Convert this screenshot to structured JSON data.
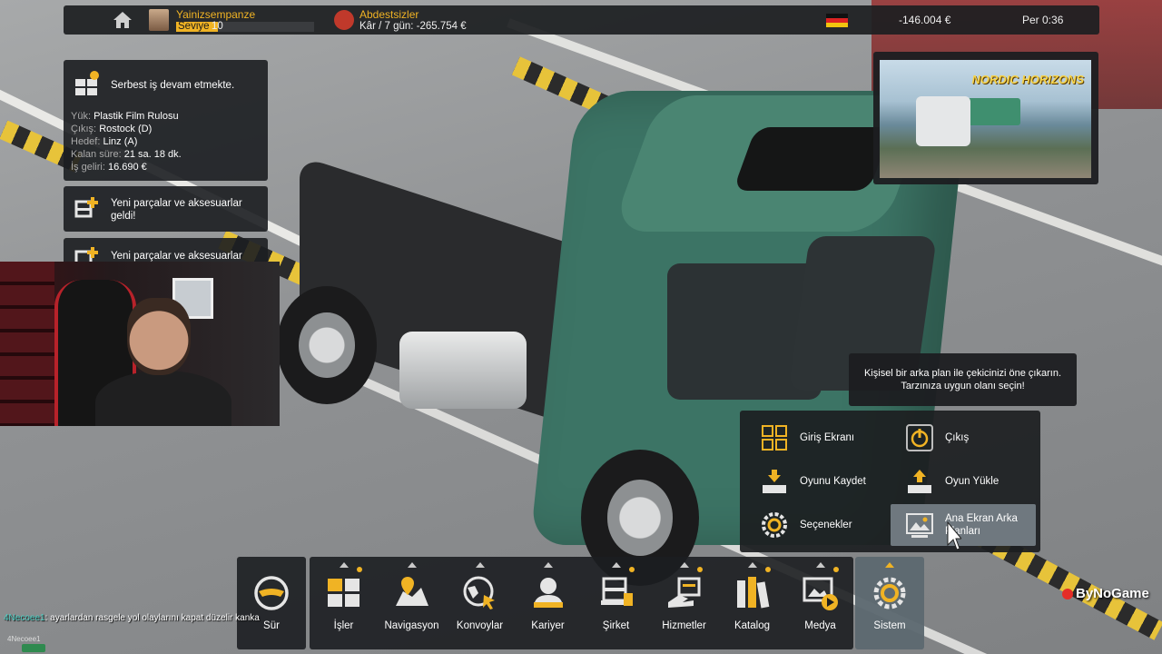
{
  "topbar": {
    "user_name": "Yainizsempanze",
    "level_label": "Seviye",
    "level_value": "10",
    "level_progress": 0.3,
    "company_name": "Abdestsizler",
    "company_stat": "Kâr / 7 gün: -265.754 €",
    "money": "-146.004 €",
    "time": "Per 0:36"
  },
  "notifications": {
    "job": {
      "title": "Serbest iş devam etmekte.",
      "cargo_label": "Yük:",
      "cargo_value": "Plastik Film Rulosu",
      "origin_label": "Çıkış:",
      "origin_value": "Rostock (D)",
      "destination_label": "Hedef:",
      "destination_value": "Linz (A)",
      "remaining_label": "Kalan süre:",
      "remaining_value": "21 sa. 18 dk.",
      "income_label": "İş geliri:",
      "income_value": "16.690 €"
    },
    "parts1": {
      "line1": "Yeni parçalar ve aksesuarlar",
      "line2": "geldi!"
    },
    "parts2": {
      "line1": "Yeni parçalar ve aksesuarlar"
    }
  },
  "promo": {
    "title": "NORDIC HORIZONS"
  },
  "tooltip": {
    "line1": "Kişisel bir arka plan ile çekicinizi öne çıkarın.",
    "line2": "Tarzınıza uygun olanı seçin!"
  },
  "system_menu": {
    "items": [
      {
        "label": "Giriş Ekranı",
        "icon": "grid-icon"
      },
      {
        "label": "Çıkış",
        "icon": "power-icon"
      },
      {
        "label": "Oyunu Kaydet",
        "icon": "save-icon"
      },
      {
        "label": "Oyun Yükle",
        "icon": "load-icon"
      },
      {
        "label": "Seçenekler",
        "icon": "gear-icon"
      },
      {
        "label_line1": "Ana Ekran Arka",
        "label_line2": "Planları",
        "icon": "image-icon"
      }
    ]
  },
  "bottombar": {
    "drive_label": "Sür",
    "items": [
      {
        "label": "İşler",
        "icon": "crates-icon",
        "dot": true
      },
      {
        "label": "Navigasyon",
        "icon": "map-icon",
        "dot": false
      },
      {
        "label": "Konvoylar",
        "icon": "globe-cursor-icon",
        "dot": false
      },
      {
        "label": "Kariyer",
        "icon": "person-icon",
        "dot": false
      },
      {
        "label": "Şirket",
        "icon": "truck-icon",
        "dot": true
      },
      {
        "label": "Hizmetler",
        "icon": "services-icon",
        "dot": true
      },
      {
        "label": "Katalog",
        "icon": "books-icon",
        "dot": true
      },
      {
        "label": "Medya",
        "icon": "media-icon",
        "dot": true
      }
    ],
    "system_label": "Sistem"
  },
  "chat": {
    "user": "4Necoee1",
    "message": ": ayarlardan rasgele yol olaylarını kapat düzelir kanka",
    "user2": "4Necoee1"
  },
  "watermark": {
    "text": "ByNoGame"
  },
  "colors": {
    "accent": "#f0b324",
    "panel": "#1c1e21",
    "active": "#6f787f"
  }
}
